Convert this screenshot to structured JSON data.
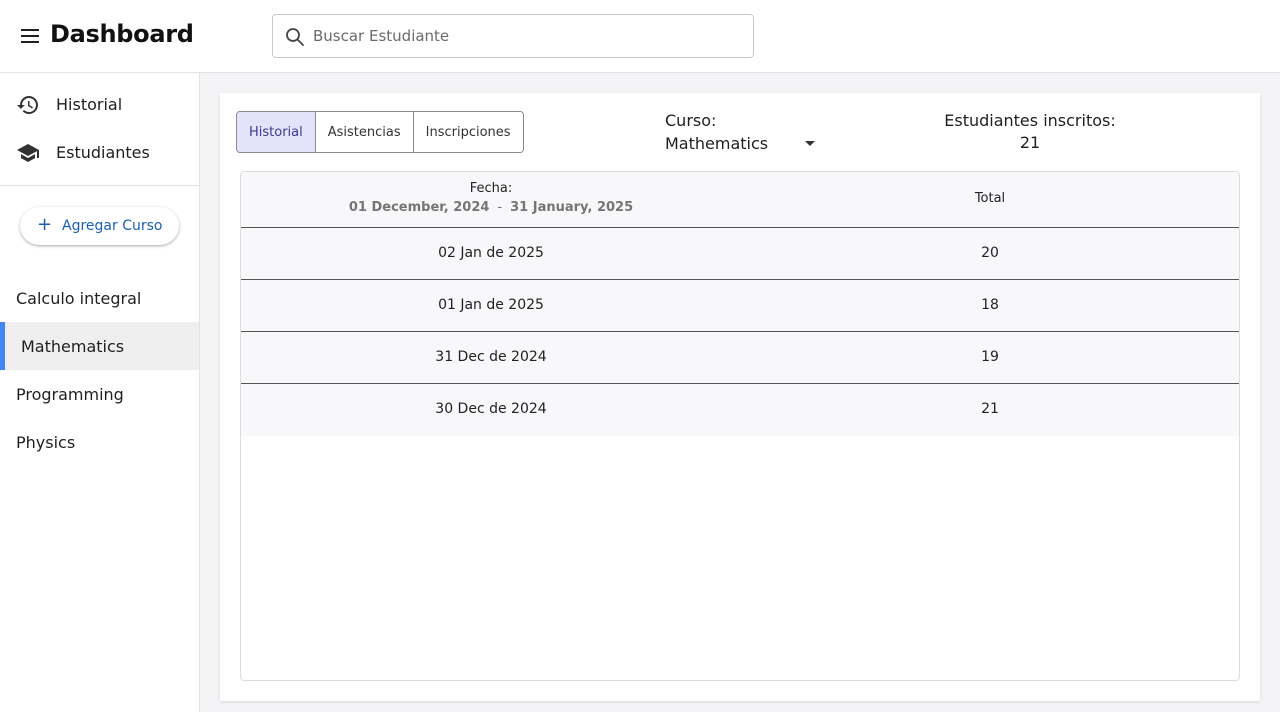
{
  "header": {
    "menu_icon": "menu-icon",
    "title": "Dashboard",
    "search": {
      "placeholder": "Buscar Estudiante",
      "value": "",
      "icon": "search-icon"
    }
  },
  "sidebar": {
    "nav": [
      {
        "label": "Historial",
        "icon": "history-icon"
      },
      {
        "label": "Estudiantes",
        "icon": "graduation-cap-icon"
      }
    ],
    "add_course_label": "Agregar Curso",
    "courses": [
      {
        "label": "Calculo integral",
        "active": false
      },
      {
        "label": "Mathematics",
        "active": true
      },
      {
        "label": "Programming",
        "active": false
      },
      {
        "label": "Physics",
        "active": false
      }
    ],
    "accent_color": "#4285f4"
  },
  "main": {
    "tabs": [
      {
        "label": "Historial",
        "selected": true
      },
      {
        "label": "Asistencias",
        "selected": false
      },
      {
        "label": "Inscripciones",
        "selected": false
      }
    ],
    "course_label": "Curso:",
    "course_value": "Mathematics",
    "enrolled_label": "Estudiantes inscritos:",
    "enrolled_value": "21",
    "table": {
      "col_date_title": "Fecha:",
      "date_range_start": "01 December, 2024",
      "date_range_sep": "-",
      "date_range_end": "31 January, 2025",
      "col_total_title": "Total",
      "rows": [
        {
          "date": "02 Jan de 2025",
          "total": "20"
        },
        {
          "date": "01 Jan de 2025",
          "total": "18"
        },
        {
          "date": "31 Dec de 2024",
          "total": "19"
        },
        {
          "date": "30 Dec de 2024",
          "total": "21"
        }
      ]
    }
  }
}
